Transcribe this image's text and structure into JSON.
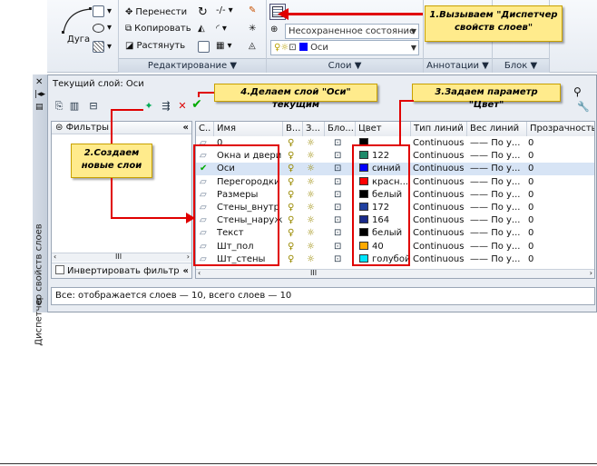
{
  "ribbon": {
    "draw": {
      "arc_label": "Дуга"
    },
    "edit": {
      "move": "Перенести",
      "copy": "Копировать",
      "stretch": "Растянуть",
      "title": "Редактирование ▼"
    },
    "layers": {
      "state_combo": "Несохраненное состояние листа",
      "layer_combo": "Оси",
      "title": "Слои ▼"
    },
    "annotations_title": "Аннотации ▼",
    "block_title": "Блок ▼"
  },
  "callouts": {
    "c1": "1.Вызываем \"Диспетчер свойств слоев\"",
    "c2": "2.Создаем новые слои",
    "c3": "3.Задаем параметр \"Цвет\"",
    "c4": "4.Делаем слой \"Оси\" текущим"
  },
  "dialog": {
    "current_layer": "Текущий слой: Оси",
    "vertical_title": "Диспетчер свойств слоев",
    "filters_header": "Фильтры",
    "invert_filter": "Инвертировать фильтр",
    "status": "Все: отображается слоев — 10, всего слоев — 10",
    "scroll_mark": "III",
    "columns": [
      "С..",
      "Имя",
      "В...",
      "З...",
      "Бло...",
      "Цвет",
      "Тип линий",
      "Вес линий",
      "Прозрачность"
    ],
    "layers": [
      {
        "name": "0",
        "color": "",
        "swatch": "#000000",
        "ltype": "Continuous",
        "lw": "По у...",
        "tr": "0"
      },
      {
        "name": "Окна и двери",
        "color": "122",
        "swatch": "#1f8a6a",
        "ltype": "Continuous",
        "lw": "По у...",
        "tr": "0"
      },
      {
        "name": "Оси",
        "color": "синий",
        "swatch": "#0000ff",
        "ltype": "Continuous",
        "lw": "По у...",
        "tr": "0"
      },
      {
        "name": "Перегородки",
        "color": "красн...",
        "swatch": "#ff0000",
        "ltype": "Continuous",
        "lw": "По у...",
        "tr": "0"
      },
      {
        "name": "Размеры",
        "color": "белый",
        "swatch": "#000000",
        "ltype": "Continuous",
        "lw": "По у...",
        "tr": "0"
      },
      {
        "name": "Стены_внутр",
        "color": "172",
        "swatch": "#2040a0",
        "ltype": "Continuous",
        "lw": "По у...",
        "tr": "0"
      },
      {
        "name": "Стены_наруж",
        "color": "164",
        "swatch": "#1a2a8a",
        "ltype": "Continuous",
        "lw": "По у...",
        "tr": "0"
      },
      {
        "name": "Текст",
        "color": "белый",
        "swatch": "#000000",
        "ltype": "Continuous",
        "lw": "По у...",
        "tr": "0"
      },
      {
        "name": "Шт_пол",
        "color": "40",
        "swatch": "#ffaa00",
        "ltype": "Continuous",
        "lw": "По у...",
        "tr": "0"
      },
      {
        "name": "Шт_стены",
        "color": "голубой",
        "swatch": "#00e5ff",
        "ltype": "Continuous",
        "lw": "По у...",
        "tr": "0"
      }
    ]
  }
}
